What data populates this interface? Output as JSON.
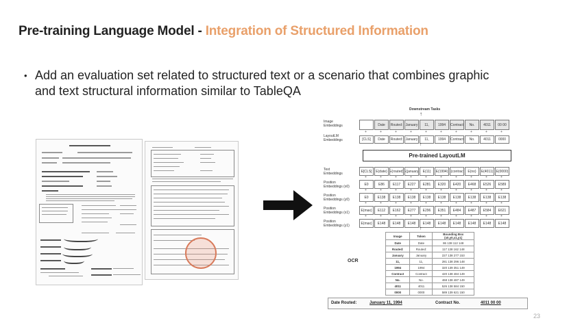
{
  "slide": {
    "title_main": "Pre-training Language Model - ",
    "title_accent": "Integration of Structured Information",
    "bullet_symbol": "•",
    "bullet_line1": "Add an evaluation set related to structured text or a scenario that combines graphic",
    "bullet_line2": "and text structural information similar to TableQA",
    "page_number": "23",
    "accent_color": "#e9a06a"
  },
  "diagram": {
    "row_labels": {
      "image": "Image\nEmbeddings",
      "layoutlm": "LayoutLM\nEmbeddings",
      "text": "Text\nEmbeddings",
      "pos_x0": "Position\nEmbeddings (x0)",
      "pos_y0": "Position\nEmbeddings (y0)",
      "pos_x1": "Position\nEmbeddings (x1)",
      "pos_y1": "Position\nEmbeddings (y1)"
    },
    "image_tokens": [
      "",
      "Date",
      "Routed:",
      "January",
      "11,",
      "1994",
      "Contract",
      "No.",
      "4011",
      "00 00"
    ],
    "layoutlm_tokens": [
      "[CLS]",
      "Date",
      "Routed:",
      "January",
      "11,",
      "1994",
      "Contract",
      "No.",
      "4011",
      "0000"
    ],
    "pretrained_label": "Pre-trained LayoutLM",
    "text_tokens": [
      "E[CLS]",
      "E(date)",
      "E(routed)",
      "E(january)",
      "E(11)",
      "E(1994)",
      "E(contract)",
      "E(no)",
      "E(4011)",
      "E(0000)"
    ],
    "pos_x0_tokens": [
      "E0",
      "E86",
      "E117",
      "E227",
      "E281",
      "E320",
      "E420",
      "E468",
      "E526",
      "E589"
    ],
    "pos_y0_tokens": [
      "E0",
      "E138",
      "E138",
      "E138",
      "E138",
      "E138",
      "E138",
      "E138",
      "E138",
      "E138"
    ],
    "pos_x1_tokens": [
      "E(max)",
      "E112",
      "E162",
      "E277",
      "E296",
      "E351",
      "E484",
      "E487",
      "E584",
      "E621"
    ],
    "pos_y1_tokens": [
      "E(max)",
      "E148",
      "E148",
      "E148",
      "E148",
      "E148",
      "E148",
      "E148",
      "E148",
      "E148"
    ],
    "ocr_label": "OCR",
    "ocr_headers": [
      "Image",
      "Token",
      "Bounding Box\n(x0,y0,x1,y1)"
    ],
    "ocr_rows": [
      [
        "Date",
        "Date",
        "86 138 112 148"
      ],
      [
        "Routed:",
        "Routed:",
        "117 138 162 148"
      ],
      [
        "January",
        "January",
        "227 138 277 153"
      ],
      [
        "11,",
        "11,",
        "281 138 296 148"
      ],
      [
        "1994",
        "1994",
        "320 139 351 149"
      ],
      [
        "Contract",
        "Contract",
        "420 138 484 149"
      ],
      [
        "No.",
        "No.",
        "468 138 487 149"
      ],
      [
        "4011",
        "4011",
        "526 138 584 150"
      ],
      [
        "0000",
        "0000",
        "589 139 621 150"
      ]
    ],
    "bottom_date_label": "Date Routed:",
    "bottom_date_value": "January 11, 1994",
    "bottom_contract_label": "Contract No.",
    "bottom_contract_value": "4011 00 00",
    "downstream_label": "Downstream Tasks"
  }
}
